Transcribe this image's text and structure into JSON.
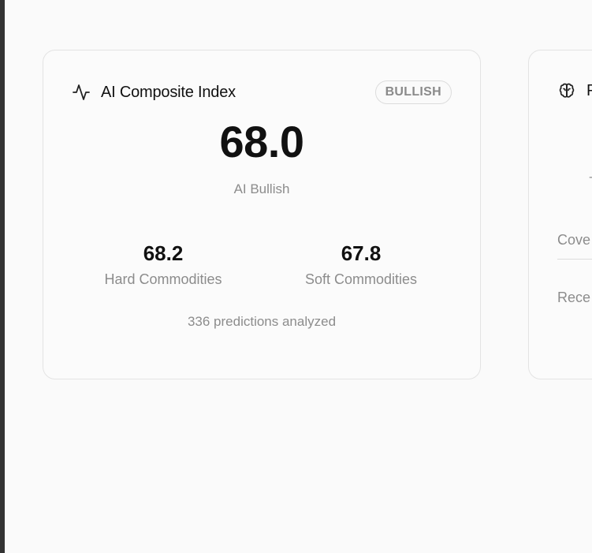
{
  "main_card": {
    "title": "AI Composite Index",
    "icon": "activity-icon",
    "badge": "BULLISH",
    "value": "68.0",
    "value_label": "AI Bullish",
    "hard": {
      "value": "68.2",
      "label": "Hard Commodities"
    },
    "soft": {
      "value": "67.8",
      "label": "Soft Commodities"
    },
    "footer": "336 predictions analyzed"
  },
  "peek_card": {
    "icon": "brain-icon",
    "title_fragment": "P",
    "mark_fragment": "-",
    "coverage_fragment": "Cove",
    "recent_fragment": "Rece"
  }
}
